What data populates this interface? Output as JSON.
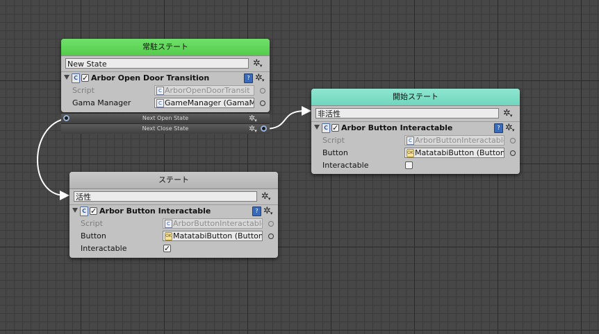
{
  "nodes": {
    "resident": {
      "title": "常駐ステート",
      "name": "New State",
      "behaviour": {
        "title": "Arbor Open Door Transition",
        "script_label": "Script",
        "script_value": "ArborOpenDoorTransit",
        "manager_label": "Gama Manager",
        "manager_value": "GameManager (GamaMa"
      },
      "transitions": [
        "Next Open State",
        "Next Close State"
      ]
    },
    "start": {
      "title": "開始ステート",
      "name": "非活性",
      "behaviour": {
        "title": "Arbor Button Interactable",
        "script_label": "Script",
        "script_value": "ArborButtonInteractable",
        "button_label": "Button",
        "button_value": "MatatabiButton (Button)",
        "interactable_label": "Interactable",
        "interactable": false
      }
    },
    "state": {
      "title": "ステート",
      "name": "活性",
      "behaviour": {
        "title": "Arbor Button Interactable",
        "script_label": "Script",
        "script_value": "ArborButtonInteractable",
        "button_label": "Button",
        "button_value": "MatatabiButton (Button)",
        "interactable_label": "Interactable",
        "interactable": true
      }
    }
  },
  "icons": {
    "gear": "gear-icon",
    "help": "help-book-icon",
    "script": "script-icon",
    "foldout": "foldout-triangle-icon",
    "object": "object-ok-icon"
  },
  "colors": {
    "resident_header": "#5fd657",
    "start_header": "#7ddcc5",
    "normal_header": "#bdbdbd",
    "canvas": "#474747",
    "wire": "#ffffff"
  },
  "glyphs": {
    "check": "✓",
    "gear": "✲",
    "help": "?",
    "script": "C",
    "ok": "OK"
  }
}
